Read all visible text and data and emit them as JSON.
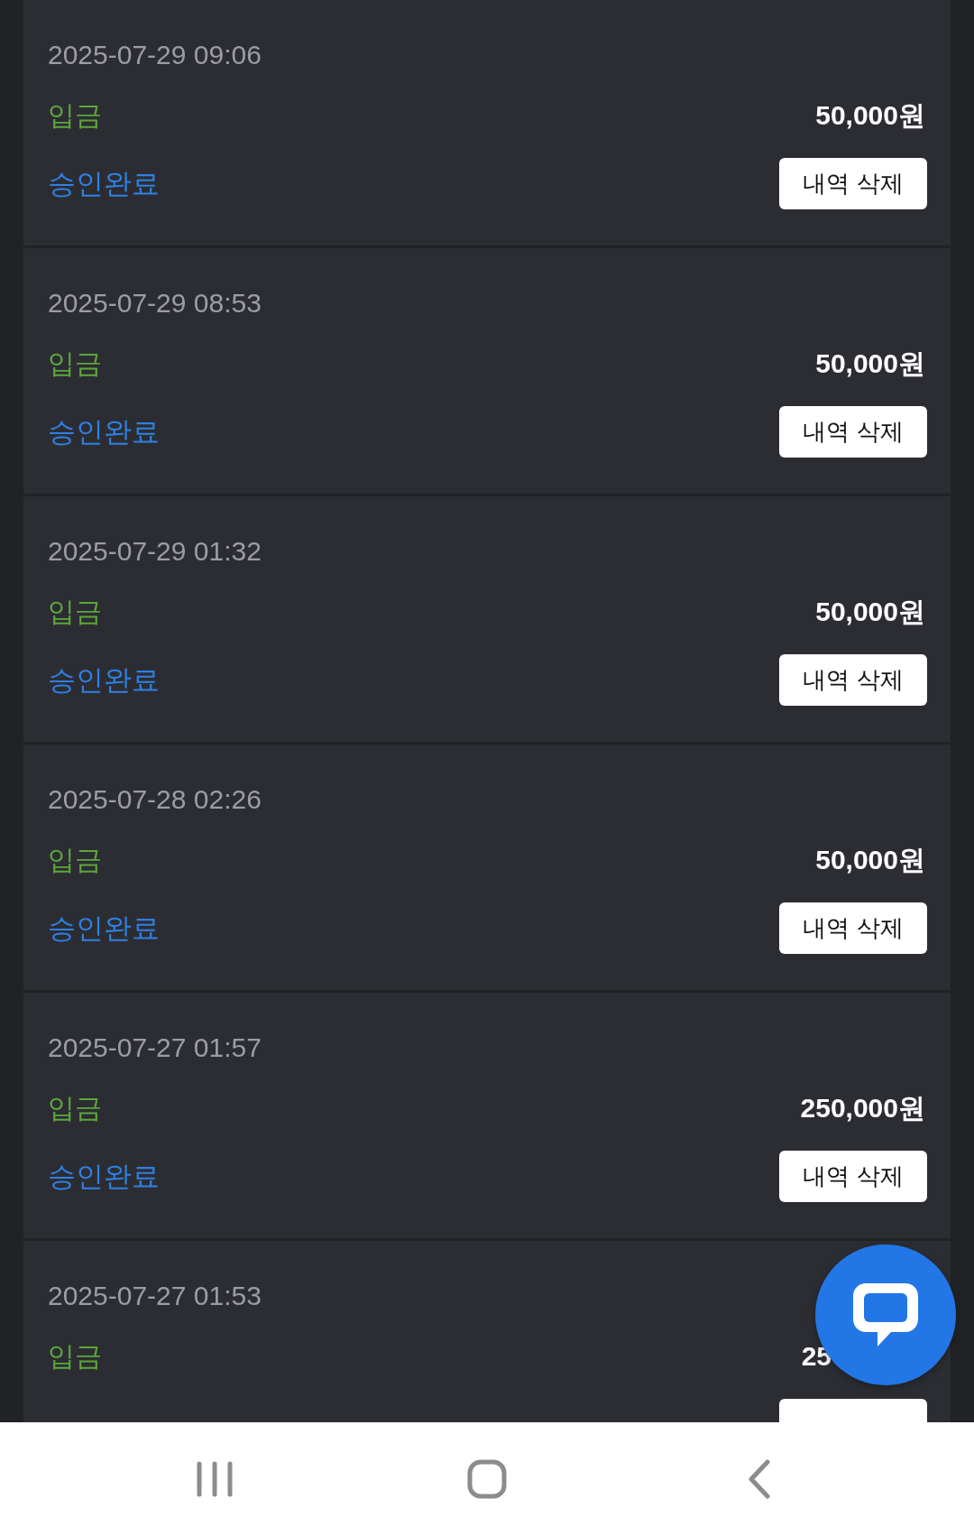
{
  "transactions": [
    {
      "datetime": "2025-07-29 09:06",
      "type": "입금",
      "amount": "50,000원",
      "status": "승인완료",
      "action": "내역 삭제"
    },
    {
      "datetime": "2025-07-29 08:53",
      "type": "입금",
      "amount": "50,000원",
      "status": "승인완료",
      "action": "내역 삭제"
    },
    {
      "datetime": "2025-07-29 01:32",
      "type": "입금",
      "amount": "50,000원",
      "status": "승인완료",
      "action": "내역 삭제"
    },
    {
      "datetime": "2025-07-28 02:26",
      "type": "입금",
      "amount": "50,000원",
      "status": "승인완료",
      "action": "내역 삭제"
    },
    {
      "datetime": "2025-07-27 01:57",
      "type": "입금",
      "amount": "250,000원",
      "status": "승인완료",
      "action": "내역 삭제"
    },
    {
      "datetime": "2025-07-27 01:53",
      "type": "입금",
      "amount": "25"
    }
  ]
}
